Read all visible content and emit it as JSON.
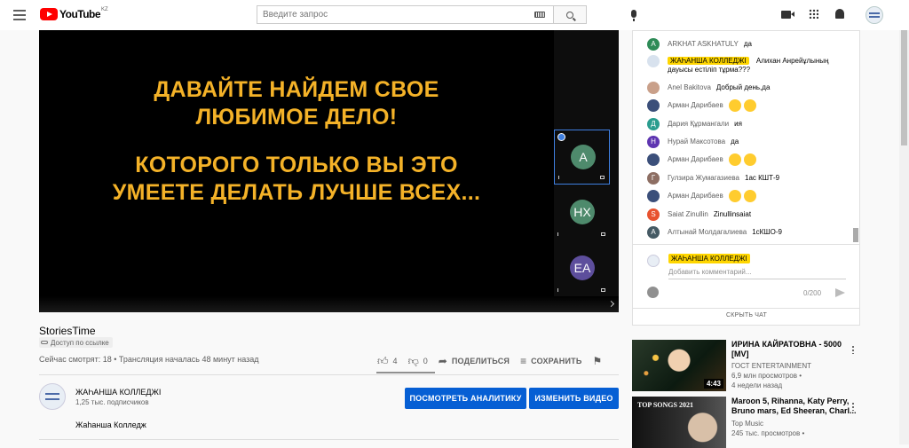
{
  "header": {
    "logo_text": "YouTube",
    "country": "KZ",
    "search_placeholder": "Введите запрос"
  },
  "player": {
    "slide_line1": "ДАВАЙТЕ НАЙДЕМ СВОЕ",
    "slide_line2": "ЛЮБИМОЕ ДЕЛО!",
    "slide_line3": "КОТОРОГО ТОЛЬКО ВЫ ЭТО",
    "slide_line4": "УМЕЕТЕ ДЕЛАТЬ ЛУЧШЕ ВСЕХ...",
    "tiles": [
      {
        "initials": "A",
        "color": "#4e8a6c"
      },
      {
        "initials": "НХ",
        "color": "#4e8a6c"
      },
      {
        "initials": "EA",
        "color": "#5d4e9c"
      }
    ]
  },
  "video": {
    "title": "StoriesTime",
    "access": "Доступ по ссылке",
    "viewers": "Сейчас смотрят: 18 • Трансляция началась 48 минут назад",
    "likes": "4",
    "dislikes": "0",
    "share_label": "ПОДЕЛИТЬСЯ",
    "save_label": "СОХРАНИТЬ"
  },
  "channel": {
    "name": "ЖАҺАНША КОЛЛЕДЖІ",
    "subscribers": "1,25 тыс. подписчиков",
    "description": "Жаһанша Колледж",
    "analytics_button": "ПОСМОТРЕТЬ АНАЛИТИКУ",
    "edit_button": "ИЗМЕНИТЬ ВИДЕО"
  },
  "chat": {
    "messages": [
      {
        "initial": "A",
        "color": "#2e8b57",
        "author": "ARKHAT ASKHATULY",
        "text": "да",
        "owner": false,
        "emojis": 0
      },
      {
        "initial": "",
        "color": "#d8e2ee",
        "author": "ЖАҺАНША КОЛЛЕДЖІ",
        "text": "Алихан Анрейұлының",
        "text2": "дауысы естіліп тұрма???",
        "owner": true,
        "emojis": 0
      },
      {
        "initial": "",
        "color": "#c9a08a",
        "author": "Anel Bakitova",
        "text": "Добрый день,да",
        "owner": false,
        "emojis": 0
      },
      {
        "initial": "",
        "color": "#3b4f7a",
        "author": "Арман Дарибаев",
        "text": "",
        "owner": false,
        "emojis": 2
      },
      {
        "initial": "Д",
        "color": "#2a9d8f",
        "author": "Дария Құрмангали",
        "text": "ия",
        "owner": false,
        "emojis": 0
      },
      {
        "initial": "Н",
        "color": "#5e35b1",
        "author": "Нурай Максотова",
        "text": "да",
        "owner": false,
        "emojis": 0
      },
      {
        "initial": "",
        "color": "#3b4f7a",
        "author": "Арман Дарибаев",
        "text": "",
        "owner": false,
        "emojis": 2
      },
      {
        "initial": "Г",
        "color": "#8d6e63",
        "author": "Гулзира Жумагазиева",
        "text": "1ас КШТ-9",
        "owner": false,
        "emojis": 0
      },
      {
        "initial": "",
        "color": "#3b4f7a",
        "author": "Арман Дарибаев",
        "text": "",
        "owner": false,
        "emojis": 2
      },
      {
        "initial": "S",
        "color": "#e8522f",
        "author": "Saiat Zinullin",
        "text": "Zinullinsaiat",
        "owner": false,
        "emojis": 0
      },
      {
        "initial": "A",
        "color": "#455a64",
        "author": "Алтынай Молдагалиева",
        "text": "1сКШО-9",
        "owner": false,
        "emojis": 0
      }
    ],
    "input_name": "ЖАҺАНША КОЛЛЕДЖІ",
    "input_placeholder": "Добавить комментарий...",
    "char_count": "0/200",
    "hide_chat": "СКРЫТЬ ЧАТ"
  },
  "recommendations": [
    {
      "title1": "ИРИНА КАЙРАТОВНА - 5000",
      "title2": "[MV]",
      "channel": "ГОСТ ENTERTAINMENT",
      "views": "6,9 млн просмотров •",
      "age": "4 недели назад",
      "duration": "4:43"
    },
    {
      "title1": "Maroon 5, Rihanna, Katy Perry,",
      "title2": "Bruno mars, Ed Sheeran, Charl...",
      "channel": "Top Music",
      "views": "245 тыс. просмотров •",
      "thumb_text": "TOP SONGS 2021"
    }
  ]
}
